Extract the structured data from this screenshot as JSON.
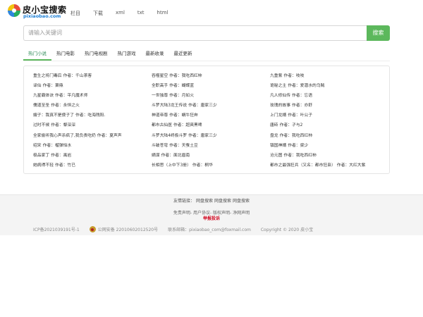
{
  "header": {
    "logo_title": "皮小宝搜索",
    "logo_sub": "pixiaobao.com",
    "nav": [
      "栏目",
      "下载",
      "xml",
      "txt",
      "html"
    ]
  },
  "search": {
    "placeholder": "请输入关键词",
    "button_label": "搜索"
  },
  "tabs": [
    {
      "label": "热门小说",
      "active": true
    },
    {
      "label": "热门电影",
      "active": false
    },
    {
      "label": "热门电视剧",
      "active": false
    },
    {
      "label": "热门游戏",
      "active": false
    },
    {
      "label": "最新收录",
      "active": false
    },
    {
      "label": "最近更新",
      "active": false
    }
  ],
  "author_label": "作者：",
  "books": {
    "col1": [
      {
        "title": "重生之将门毒后",
        "author": "千山茶客"
      },
      {
        "title": "译仙",
        "author": "萧鼎"
      },
      {
        "title": "九星霸体诀",
        "author": "平凡魔术师"
      },
      {
        "title": "儒道至圣",
        "author": "永恒之火"
      },
      {
        "title": "嫂子：我真不是傻子了",
        "author": "吃海残阳."
      },
      {
        "title": "过时不候",
        "author": "黎深深"
      },
      {
        "title": "全家偷听我心声杀疯了,我负责吃奶",
        "author": "夏声声"
      },
      {
        "title": "绍宋",
        "author": "榴弹怕水"
      },
      {
        "title": "极品家丁",
        "author": "禹岩"
      },
      {
        "title": "她病得不轻",
        "author": "竹已"
      }
    ],
    "col2": [
      {
        "title": "吞噬星空",
        "author": "我吃西红柿"
      },
      {
        "title": "全职高手",
        "author": "蝴蝶蓝"
      },
      {
        "title": "一世独尊",
        "author": "月如火"
      },
      {
        "title": "斗罗大陆3龙王传说",
        "author": "唐家三少"
      },
      {
        "title": "神道帝尊",
        "author": "蜗牛狂奔"
      },
      {
        "title": "都市古仙医",
        "author": "超爽黑啤"
      },
      {
        "title": "斗罗大陆4终极斗罗",
        "author": "唐家三少"
      },
      {
        "title": "斗破苍穹",
        "author": "天蚕土豆"
      },
      {
        "title": "嫡谋",
        "author": "面北眉南"
      },
      {
        "title": "长相思（上中下3册）",
        "author": "桐华"
      }
    ],
    "col3": [
      {
        "title": "九重紫",
        "author": "吱吱"
      },
      {
        "title": "诡秘之主",
        "author": "爱潜水的乌贼"
      },
      {
        "title": "凡人修仙传",
        "author": "忘语"
      },
      {
        "title": "玫瑰的故事",
        "author": "亦舒"
      },
      {
        "title": "上门龙婿",
        "author": "叶公子"
      },
      {
        "title": "唐砖",
        "author": "孑与2"
      },
      {
        "title": "盘龙",
        "author": "我吃西红柿"
      },
      {
        "title": "镇国神婿",
        "author": "梁少"
      },
      {
        "title": "沧元图",
        "author": "我吃西红柿"
      },
      {
        "title": "都市之最强狂兵（又名：都市狂枭）",
        "author": "大红大紫"
      }
    ]
  },
  "footer": {
    "friends_label": "友情链接：",
    "friends": [
      "网盘搜索",
      "网盘搜索",
      "网盘搜索"
    ],
    "legal": "免责声明- 用户协议- 版权声明- 净网声明",
    "report": "举报投诉",
    "icp": "ICP备2021039191号-1",
    "police": "公网安备 22010602012520号",
    "contact": "联系邮箱：pixiaobao_com@foxmail.com",
    "copyright": "Copyright © 2020 皮小宝"
  },
  "colors": {
    "accent_green": "#5cb85c",
    "report_red": "#d0021b",
    "brand_blue": "#1b7fd6"
  }
}
